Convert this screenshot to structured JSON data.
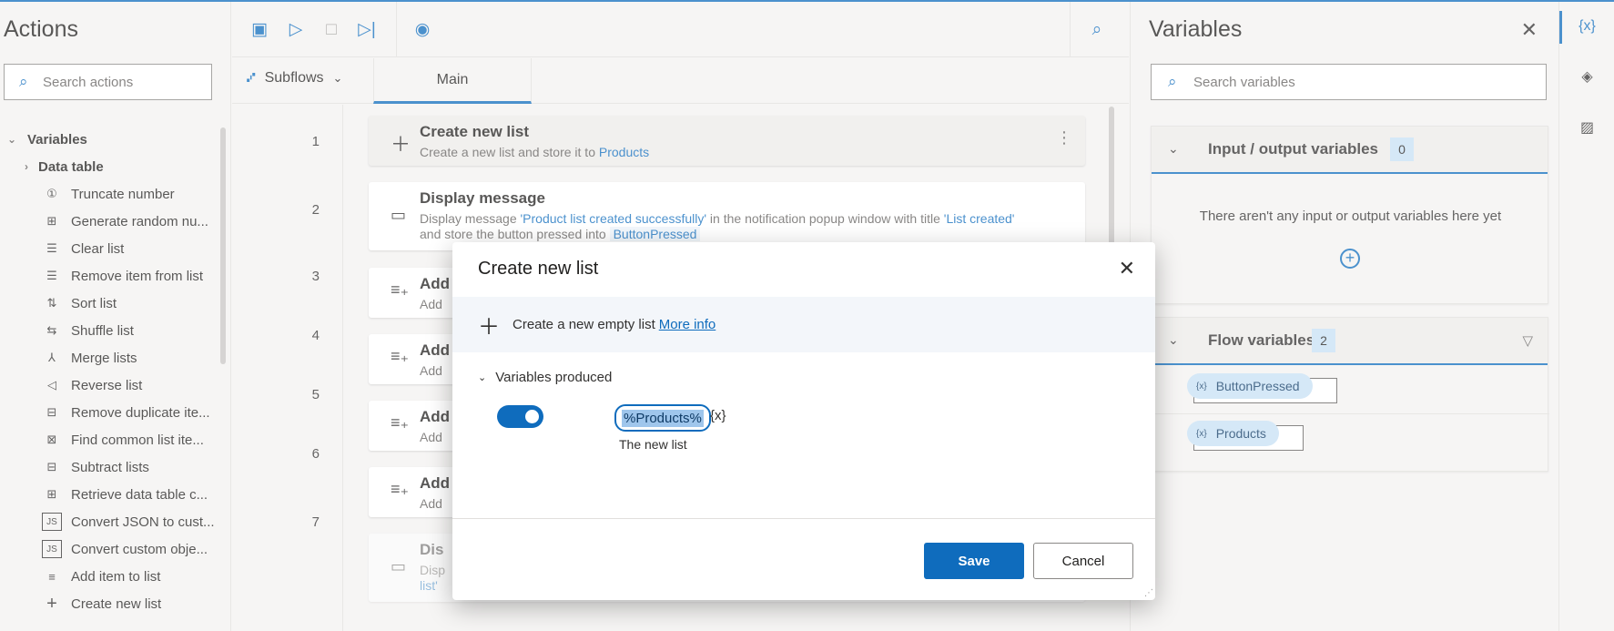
{
  "actions_panel": {
    "title": "Actions",
    "search_placeholder": "Search actions",
    "category": "Variables",
    "subcategory": "Data table",
    "items": [
      {
        "label": "Truncate number",
        "icon": "①"
      },
      {
        "label": "Generate random nu...",
        "icon": "⊞"
      },
      {
        "label": "Clear list",
        "icon": "☰"
      },
      {
        "label": "Remove item from list",
        "icon": "☰"
      },
      {
        "label": "Sort list",
        "icon": "⇅"
      },
      {
        "label": "Shuffle list",
        "icon": "⇆"
      },
      {
        "label": "Merge lists",
        "icon": "⅄"
      },
      {
        "label": "Reverse list",
        "icon": "◁"
      },
      {
        "label": "Remove duplicate ite...",
        "icon": "⊟"
      },
      {
        "label": "Find common list ite...",
        "icon": "⊠"
      },
      {
        "label": "Subtract lists",
        "icon": "⊟"
      },
      {
        "label": "Retrieve data table c...",
        "icon": "⊞"
      },
      {
        "label": "Convert JSON to cust...",
        "icon": "JS"
      },
      {
        "label": "Convert custom obje...",
        "icon": "JS"
      },
      {
        "label": "Add item to list",
        "icon": "≡"
      },
      {
        "label": "Create new list",
        "icon": "+"
      }
    ]
  },
  "designer": {
    "subflows_label": "Subflows",
    "main_tab": "Main",
    "steps": [
      {
        "num": "1",
        "title": "Create new list",
        "desc_prefix": "Create a new list and store it to ",
        "desc_var": "Products"
      },
      {
        "num": "2",
        "title": "Display message",
        "desc_a": "Display message ",
        "desc_b": "'Product list created successfully'",
        "desc_c": " in the notification popup window with title ",
        "desc_d": "'List created'",
        "desc_e": " and store the button pressed into ",
        "desc_f": "ButtonPressed"
      },
      {
        "num": "3",
        "title": "Add",
        "desc": "Add"
      },
      {
        "num": "4",
        "title": "Add",
        "desc": "Add"
      },
      {
        "num": "5",
        "title": "Add",
        "desc": "Add"
      },
      {
        "num": "6",
        "title": "Add",
        "desc": "Add"
      },
      {
        "num": "7",
        "title": "Dis",
        "desc_a": "Disp",
        "desc_b": "list'"
      }
    ]
  },
  "variables_panel": {
    "title": "Variables",
    "search_placeholder": "Search variables",
    "io_section": {
      "label": "Input / output variables",
      "count": "0",
      "empty_text": "There aren't any input or output variables here yet"
    },
    "flow_section": {
      "label": "Flow variables",
      "count": "2",
      "items": [
        "ButtonPressed",
        "Products"
      ]
    }
  },
  "rail": {
    "vars_icon": "{x}"
  },
  "modal": {
    "title": "Create new list",
    "info_text": "Create a new empty list",
    "more_info": "More info",
    "variables_produced": "Variables produced",
    "variable_name": "%Products%",
    "variable_icon": "{x}",
    "variable_desc": "The new list",
    "save_label": "Save",
    "cancel_label": "Cancel"
  },
  "colors": {
    "accent": "#0f6cbd"
  }
}
